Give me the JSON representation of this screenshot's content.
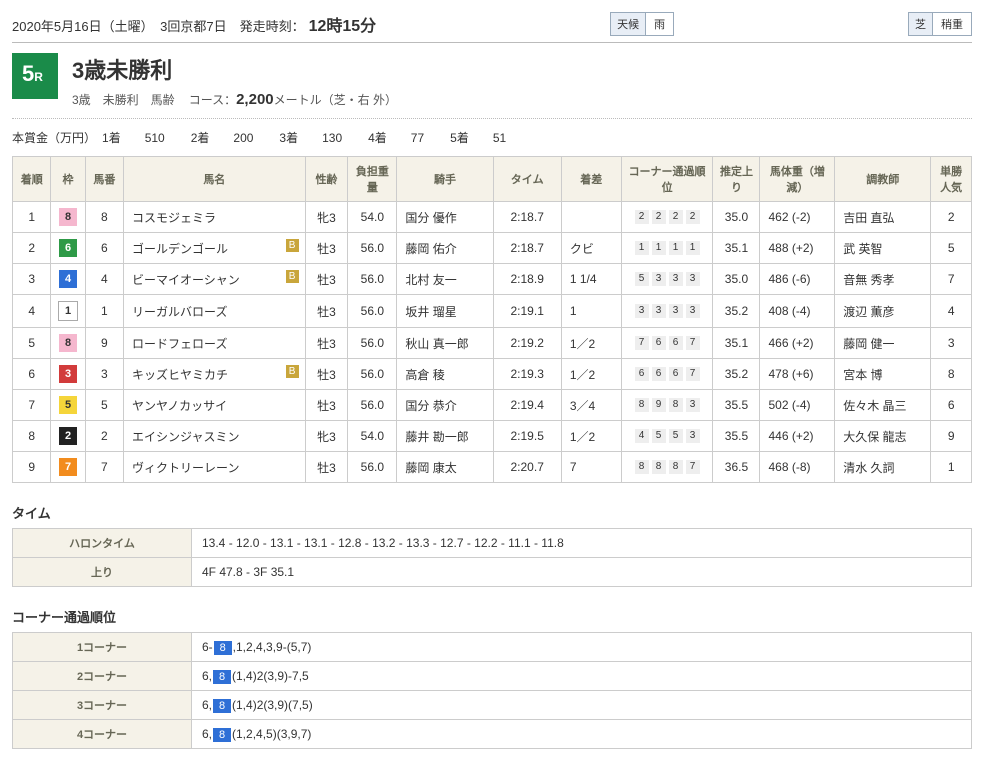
{
  "header": {
    "date_line": "2020年5月16日（土曜）　3回京都7日　発走時刻：",
    "start_time": "12時15分",
    "cond_weather_label": "天候",
    "cond_weather_val": "雨",
    "cond_track_label": "芝",
    "cond_track_val": "稍重"
  },
  "race": {
    "number": "5",
    "r": "R",
    "title": "3歳未勝利",
    "subcat": "3歳　未勝利　馬齢",
    "course_label": "コース：",
    "course_val": "2,200",
    "course_suffix": "メートル（芝・右 外）"
  },
  "prize": {
    "label": "本賞金（万円）",
    "items": [
      {
        "place": "1着",
        "amt": "510"
      },
      {
        "place": "2着",
        "amt": "200"
      },
      {
        "place": "3着",
        "amt": "130"
      },
      {
        "place": "4着",
        "amt": "77"
      },
      {
        "place": "5着",
        "amt": "51"
      }
    ]
  },
  "cols": {
    "rank": "着順",
    "waku": "枠",
    "num": "馬番",
    "name": "馬名",
    "sex": "性齢",
    "wt": "負担重量",
    "jock": "騎手",
    "time": "タイム",
    "diff": "着差",
    "corner": "コーナー通過順位",
    "last": "推定上り",
    "body": "馬体重（増減）",
    "trainer": "調教師",
    "pop": "単勝人気"
  },
  "rows": [
    {
      "rank": "1",
      "waku": "8",
      "wakuCls": "w8",
      "num": "8",
      "name": "コスモジェミラ",
      "b": "",
      "sex": "牝3",
      "wt": "54.0",
      "jock": "国分 優作",
      "time": "2:18.7",
      "diff": "",
      "corner": [
        "2",
        "2",
        "2",
        "2"
      ],
      "last": "35.0",
      "body": "462 (-2)",
      "trainer": "吉田 直弘",
      "pop": "2"
    },
    {
      "rank": "2",
      "waku": "6",
      "wakuCls": "w6",
      "num": "6",
      "name": "ゴールデンゴール",
      "b": "B",
      "sex": "牡3",
      "wt": "56.0",
      "jock": "藤岡 佑介",
      "time": "2:18.7",
      "diff": "クビ",
      "corner": [
        "1",
        "1",
        "1",
        "1"
      ],
      "last": "35.1",
      "body": "488 (+2)",
      "trainer": "武 英智",
      "pop": "5"
    },
    {
      "rank": "3",
      "waku": "4",
      "wakuCls": "w4",
      "num": "4",
      "name": "ビーマイオーシャン",
      "b": "B",
      "sex": "牡3",
      "wt": "56.0",
      "jock": "北村 友一",
      "time": "2:18.9",
      "diff": "1 1/4",
      "corner": [
        "5",
        "3",
        "3",
        "3"
      ],
      "last": "35.0",
      "body": "486 (-6)",
      "trainer": "音無 秀孝",
      "pop": "7"
    },
    {
      "rank": "4",
      "waku": "1",
      "wakuCls": "w1",
      "num": "1",
      "name": "リーガルバローズ",
      "b": "",
      "sex": "牡3",
      "wt": "56.0",
      "jock": "坂井 瑠星",
      "time": "2:19.1",
      "diff": "1",
      "corner": [
        "3",
        "3",
        "3",
        "3"
      ],
      "last": "35.2",
      "body": "408 (-4)",
      "trainer": "渡辺 薫彦",
      "pop": "4"
    },
    {
      "rank": "5",
      "waku": "8",
      "wakuCls": "w8",
      "num": "9",
      "name": "ロードフェローズ",
      "b": "",
      "sex": "牡3",
      "wt": "56.0",
      "jock": "秋山 真一郎",
      "time": "2:19.2",
      "diff": "1／2",
      "corner": [
        "7",
        "6",
        "6",
        "7"
      ],
      "last": "35.1",
      "body": "466 (+2)",
      "trainer": "藤岡 健一",
      "pop": "3"
    },
    {
      "rank": "6",
      "waku": "3",
      "wakuCls": "w3",
      "num": "3",
      "name": "キッズヒヤミカチ",
      "b": "B",
      "sex": "牡3",
      "wt": "56.0",
      "jock": "高倉 稜",
      "time": "2:19.3",
      "diff": "1／2",
      "corner": [
        "6",
        "6",
        "6",
        "7"
      ],
      "last": "35.2",
      "body": "478 (+6)",
      "trainer": "宮本 博",
      "pop": "8"
    },
    {
      "rank": "7",
      "waku": "5",
      "wakuCls": "w5",
      "num": "5",
      "name": "ヤンヤノカッサイ",
      "b": "",
      "sex": "牡3",
      "wt": "56.0",
      "jock": "国分 恭介",
      "time": "2:19.4",
      "diff": "3／4",
      "corner": [
        "8",
        "9",
        "8",
        "3"
      ],
      "last": "35.5",
      "body": "502 (-4)",
      "trainer": "佐々木 晶三",
      "pop": "6"
    },
    {
      "rank": "8",
      "waku": "2",
      "wakuCls": "w2",
      "num": "2",
      "name": "エイシンジャスミン",
      "b": "",
      "sex": "牝3",
      "wt": "54.0",
      "jock": "藤井 勘一郎",
      "time": "2:19.5",
      "diff": "1／2",
      "corner": [
        "4",
        "5",
        "5",
        "3"
      ],
      "last": "35.5",
      "body": "446 (+2)",
      "trainer": "大久保 龍志",
      "pop": "9"
    },
    {
      "rank": "9",
      "waku": "7",
      "wakuCls": "w7",
      "num": "7",
      "name": "ヴィクトリーレーン",
      "b": "",
      "sex": "牡3",
      "wt": "56.0",
      "jock": "藤岡 康太",
      "time": "2:20.7",
      "diff": "7",
      "corner": [
        "8",
        "8",
        "8",
        "7"
      ],
      "last": "36.5",
      "body": "468 (-8)",
      "trainer": "清水 久詞",
      "pop": "1"
    }
  ],
  "time_sec": {
    "title": "タイム",
    "rows": [
      {
        "k": "ハロンタイム",
        "v": "13.4 - 12.0 - 13.1 - 13.1 - 12.8 - 13.2 - 13.3 - 12.7 - 12.2 - 11.1 - 11.8"
      },
      {
        "k": "上り",
        "v": "4F 47.8 - 3F 35.1"
      }
    ]
  },
  "corner_sec": {
    "title": "コーナー通過順位",
    "box_num": "8",
    "rows": [
      {
        "k": "1コーナー",
        "pre": "6-",
        "post": ",1,2,4,3,9-(5,7)"
      },
      {
        "k": "2コーナー",
        "pre": "6,",
        "post": "(1,4)2(3,9)-7,5"
      },
      {
        "k": "3コーナー",
        "pre": "6,",
        "post": "(1,4)2(3,9)(7,5)"
      },
      {
        "k": "4コーナー",
        "pre": "6,",
        "post": "(1,2,4,5)(3,9,7)"
      }
    ]
  },
  "chart_data": {
    "type": "table",
    "title": "3歳未勝利 結果",
    "columns": [
      "着順",
      "枠",
      "馬番",
      "馬名",
      "性齢",
      "負担重量",
      "騎手",
      "タイム",
      "着差",
      "コーナー通過順位",
      "推定上り",
      "馬体重（増減）",
      "調教師",
      "単勝人気"
    ]
  }
}
